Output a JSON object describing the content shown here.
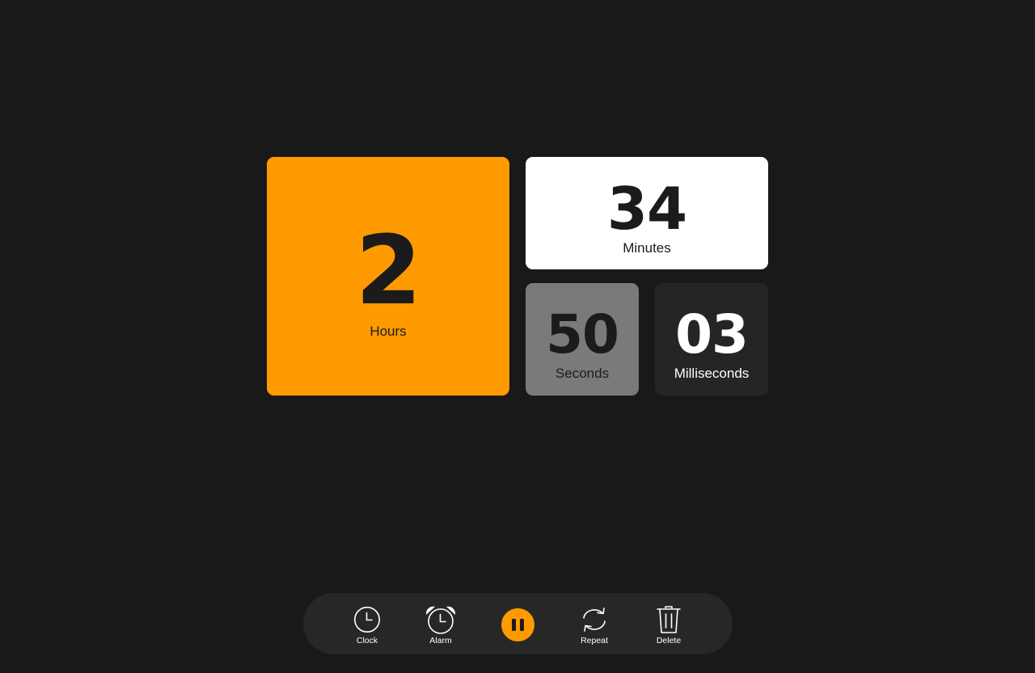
{
  "timer": {
    "hours": {
      "value": "2",
      "label": "Hours"
    },
    "minutes": {
      "value": "34",
      "label": "Minutes"
    },
    "seconds": {
      "value": "50",
      "label": "Seconds"
    },
    "milliseconds": {
      "value": "03",
      "label": "Milliseconds"
    }
  },
  "dock": {
    "clock": {
      "label": "Clock",
      "icon": "clock-icon"
    },
    "alarm": {
      "label": "Alarm",
      "icon": "alarm-icon"
    },
    "pause": {
      "icon": "pause-icon"
    },
    "repeat": {
      "label": "Repeat",
      "icon": "repeat-icon"
    },
    "delete": {
      "label": "Delete",
      "icon": "trash-icon"
    }
  },
  "colors": {
    "accent": "#ff9a00",
    "background": "#191919",
    "tile_white": "#ffffff",
    "tile_gray": "#7a7a7a",
    "tile_dark": "#252525",
    "dock": "#272727"
  }
}
